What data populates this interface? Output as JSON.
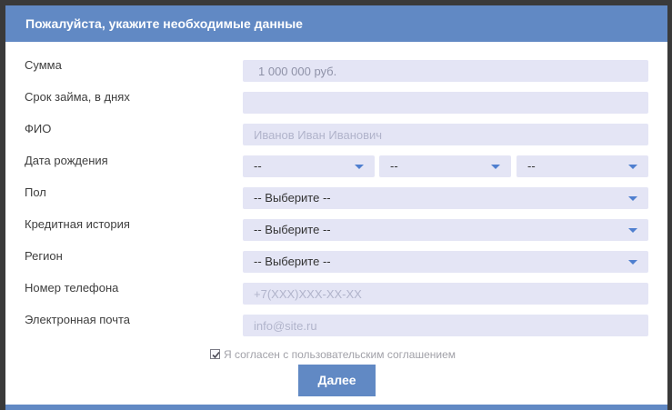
{
  "modal": {
    "title": "Пожалуйста, укажите необходимые данные"
  },
  "form": {
    "amount": {
      "label": "Сумма",
      "value": "1 000 000 руб."
    },
    "term": {
      "label": "Срок займа, в днях",
      "value": ""
    },
    "fio": {
      "label": "ФИО",
      "placeholder": "Иванов Иван Иванович"
    },
    "birthdate": {
      "label": "Дата рождения",
      "day": "--",
      "month": "--",
      "year": "--"
    },
    "gender": {
      "label": "Пол",
      "value": "-- Выберите --"
    },
    "credit_history": {
      "label": "Кредитная история",
      "value": "-- Выберите --"
    },
    "region": {
      "label": "Регион",
      "value": "-- Выберите --"
    },
    "phone": {
      "label": "Номер телефона",
      "placeholder": "+7(XXX)XXX-XX-XX"
    },
    "email": {
      "label": "Электронная почта",
      "placeholder": "info@site.ru"
    },
    "agreement": {
      "label": "Я согласен с пользовательским соглашением",
      "checked": true
    },
    "submit_label": "Далее"
  },
  "colors": {
    "header": "#6189c4",
    "field_bg": "#e4e5f5",
    "arrow": "#4f7fcf"
  }
}
